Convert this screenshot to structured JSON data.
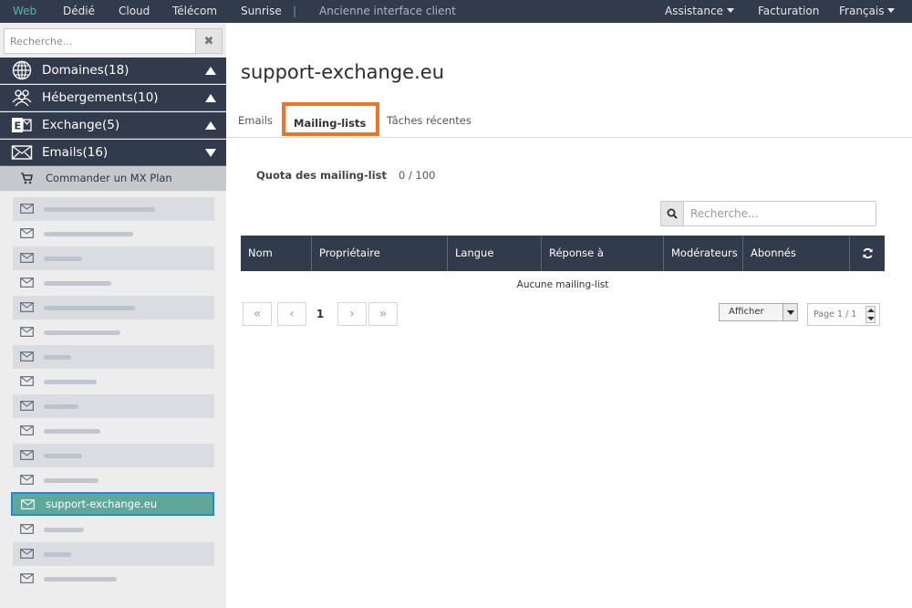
{
  "topnav": {
    "left": [
      "Web",
      "Dédié",
      "Cloud",
      "Télécom",
      "Sunrise"
    ],
    "separator": "|",
    "old_interface": "Ancienne interface client",
    "right": [
      "Assistance",
      "Facturation",
      "Français"
    ]
  },
  "sidebar": {
    "search_placeholder": "Recherche...",
    "categories": [
      {
        "label": "Domaines(18)",
        "icon": "globe-icon",
        "state": "collapsed"
      },
      {
        "label": "Hébergements(10)",
        "icon": "users-icon",
        "state": "collapsed"
      },
      {
        "label": "Exchange(5)",
        "icon": "exchange-icon",
        "state": "collapsed"
      },
      {
        "label": "Emails(16)",
        "icon": "envelope-icon",
        "state": "expanded"
      }
    ],
    "order_label": "Commander un MX Plan",
    "selected_domain": "support-exchange.eu"
  },
  "main": {
    "title": "support-exchange.eu",
    "tabs": [
      "Emails",
      "Mailing-lists",
      "Tâches récentes"
    ],
    "active_tab": "Mailing-lists",
    "quota_label": "Quota des mailing-list",
    "quota_value": "0 / 100",
    "search_placeholder": "Recherche...",
    "columns": [
      "Nom",
      "Propriétaire",
      "Langue",
      "Réponse à",
      "Modérateurs",
      "Abonnés"
    ],
    "empty_text": "Aucune mailing-list",
    "pagination": {
      "first": "«",
      "prev": "‹",
      "current": "1",
      "next": "›",
      "last": "»"
    },
    "show_select": "Afficher",
    "page_indicator": "Page 1 / 1"
  },
  "colors": {
    "navy": "#323b4c",
    "accent_teal": "#59b5a4",
    "highlight_orange": "#f27423",
    "selection_blue": "#1e88e5"
  }
}
